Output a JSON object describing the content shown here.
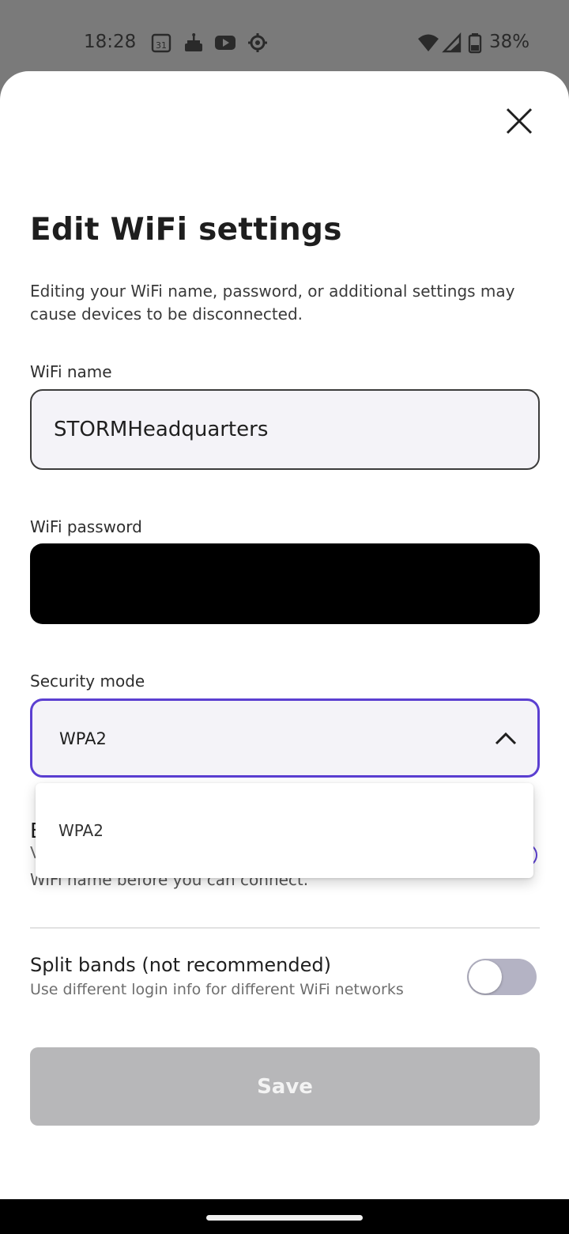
{
  "status_bar": {
    "time": "18:28",
    "calendar_day": "31",
    "battery": "38%",
    "icons": [
      "calendar-icon",
      "cake-icon",
      "youtube-icon",
      "settings-icon",
      "wifi-icon",
      "signal-icon",
      "battery-icon"
    ]
  },
  "sheet": {
    "title": "Edit WiFi settings",
    "description": "Editing your WiFi name, password, or additional settings may cause devices to be disconnected.",
    "wifi_name": {
      "label": "WiFi name",
      "value": "STORMHeadquarters"
    },
    "wifi_password": {
      "label": "WiFi password"
    },
    "security_mode": {
      "label": "Security mode",
      "value": "WPA2",
      "options": [
        "WPA2"
      ]
    },
    "obscured_setting": {
      "title_fragment": "E",
      "subtitle_fragment": "V",
      "subtitle_line2": "WiFi name before you can connect."
    },
    "split_bands": {
      "title": "Split bands (not recommended)",
      "subtitle": "Use different login info for different WiFi networks",
      "enabled": false
    },
    "save_label": "Save"
  },
  "colors": {
    "accent": "#5b3fd1",
    "field_bg": "#f4f3f8",
    "save_disabled": "#b7b7b9",
    "toggle_off": "#b4b3c4"
  }
}
